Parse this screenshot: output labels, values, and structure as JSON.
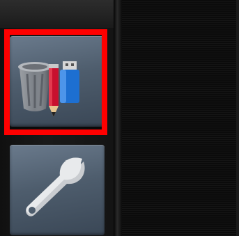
{
  "sidebar": {
    "items": [
      {
        "icon": "trash-pencil-usb-icon",
        "selected": true
      },
      {
        "icon": "wrench-icon",
        "selected": false
      }
    ]
  },
  "colors": {
    "highlight": "#ff0000",
    "tile": "#5a6a7b",
    "panel": "#0b0b0b"
  }
}
